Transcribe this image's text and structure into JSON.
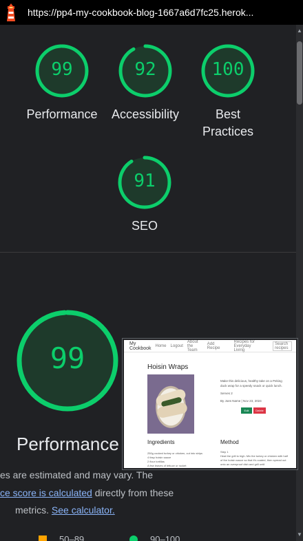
{
  "header": {
    "url": "https://pp4-my-cookbook-blog-1667a6d7fc25.herok..."
  },
  "gauges": [
    {
      "score": "99",
      "label": "Performance"
    },
    {
      "score": "92",
      "label": "Accessibility"
    },
    {
      "score": "100",
      "label": "Best Practices",
      "label_line1": "Best",
      "label_line2": "Practices"
    },
    {
      "score": "91",
      "label": "SEO"
    }
  ],
  "performance": {
    "score": "99",
    "title": "Performance",
    "note_line1": "es are estimated and may vary. The",
    "note_link1": "ce score is calculated",
    "note_line2_rest": " directly from these",
    "note_line3": "metrics. ",
    "note_link2": "See calculator.",
    "legend": [
      {
        "shape": "square",
        "color": "#ffa400",
        "range": "50–89"
      },
      {
        "shape": "circle",
        "color": "#0cce6b",
        "range": "90–100"
      }
    ]
  },
  "thumbnail": {
    "brand": "My Cookbook",
    "nav": [
      "Home",
      "Logout",
      "About the Team",
      "Add Recipe"
    ],
    "tagline": "Recipes for Everyday Living",
    "search": "Search recipes",
    "recipe_title": "Hoisin Wraps",
    "description": "Make this delicious, healthy take on a Peking duck wrap for a speedy snack or quick lunch.",
    "serves": "Serves 2",
    "byline": "By Joes Name | Nov 23, 2024",
    "edit_label": "Edit",
    "delete_label": "Delete",
    "ingredients_heading": "Ingredients",
    "ingredients": [
      "250g cooked turkey or chicken, cut into strips",
      "4 tbsp hoisin sauce",
      "2 flour tortillas",
      "A few leaves of lettuce or rocket"
    ],
    "method_heading": "Method",
    "step_label": "Step 1",
    "step_text": "Heat the grill to high. Mix the turkey or chicken with half of the hoisin sauce so that it's coated, then spread out onto an ovenproof dish and grill until"
  },
  "colors": {
    "pass": "#0cce6b",
    "average": "#ffa400",
    "background": "#202124"
  }
}
